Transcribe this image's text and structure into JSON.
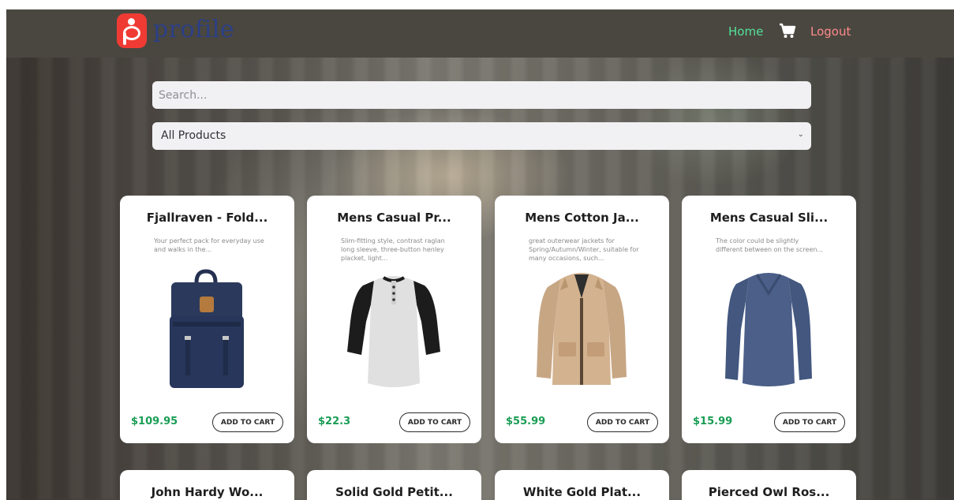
{
  "nav": {
    "brand": "profile",
    "home_label": "Home",
    "logout_label": "Logout",
    "colors": {
      "home": "#52e39a",
      "logout": "#ff8a8a",
      "logo_bg": "#ef3b33"
    }
  },
  "search": {
    "placeholder": "Search..."
  },
  "filter": {
    "selected": "All Products"
  },
  "products": [
    {
      "title": "Fjallraven - Fold...",
      "description": "Your perfect pack for everyday use and walks in the...",
      "price": "$109.95",
      "button": "ADD TO CART",
      "icon": "backpack-image"
    },
    {
      "title": "Mens Casual Pr...",
      "description": "Slim-fitting style, contrast raglan long sleeve, three-button henley placket, light...",
      "price": "$22.3",
      "button": "ADD TO CART",
      "icon": "raglan-shirt-image"
    },
    {
      "title": "Mens Cotton Ja...",
      "description": "great outerwear jackets for Spring/Autumn/Winter, suitable for many occasions, such...",
      "price": "$55.99",
      "button": "ADD TO CART",
      "icon": "jacket-image"
    },
    {
      "title": "Mens Casual Sli...",
      "description": "The color could be slightly different between on the screen...",
      "price": "$15.99",
      "button": "ADD TO CART",
      "icon": "long-sleeve-shirt-image"
    }
  ],
  "products_row2": [
    {
      "title": "John Hardy Wo..."
    },
    {
      "title": "Solid Gold Petit..."
    },
    {
      "title": "White Gold Plat..."
    },
    {
      "title": "Pierced Owl Ros..."
    }
  ],
  "colors": {
    "price": "#1a9d55",
    "navbar": "#4a4740"
  }
}
